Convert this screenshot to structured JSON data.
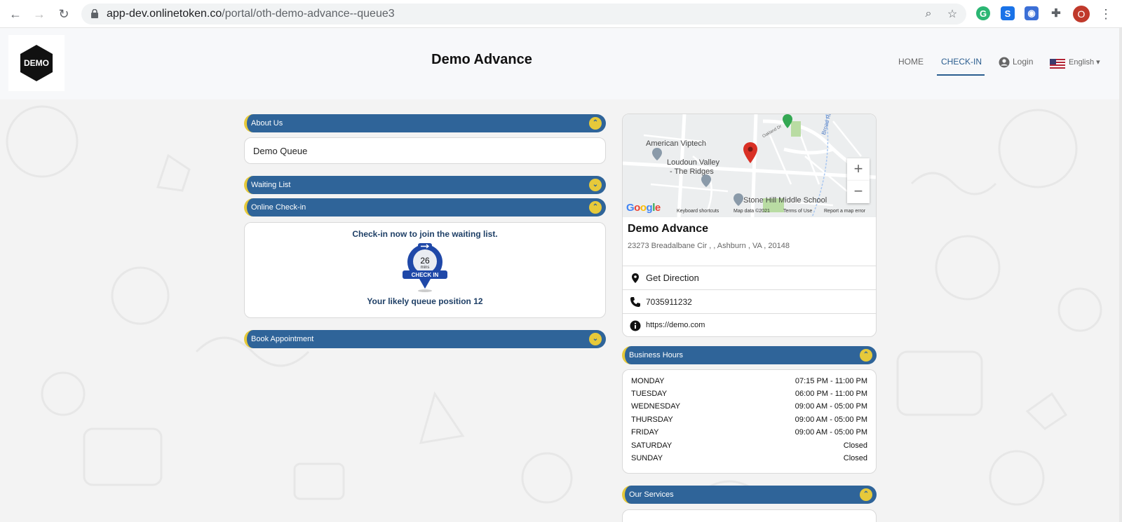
{
  "browser": {
    "url_host": "app-dev.onlinetoken.co",
    "url_path": "/portal/oth-demo-advance--queue3",
    "avatar_letter": "O"
  },
  "header": {
    "logo_text": "DEMO",
    "title": "Demo Advance",
    "nav": {
      "home": "HOME",
      "checkin": "CHECK-IN",
      "login": "Login",
      "language": "English"
    }
  },
  "about": {
    "label": "About Us",
    "text": "Demo Queue"
  },
  "waiting_list": {
    "label": "Waiting List"
  },
  "online_checkin": {
    "label": "Online Check-in",
    "heading": "Check-in now to join the waiting list.",
    "wait_minutes": "26",
    "wait_unit": "mins",
    "badge_label": "CHECK IN",
    "position_text": "Your likely queue position 12"
  },
  "book_appointment": {
    "label": "Book Appointment"
  },
  "map": {
    "labels": [
      "American Viptech",
      "Loudoun Valley",
      "- The Ridges",
      "Stone Hill Middle School",
      "Broad Run",
      "Oakland Dr"
    ],
    "footer": [
      "Keyboard shortcuts",
      "Map data ©2021",
      "Terms of Use",
      "Report a map error"
    ],
    "google": "Google"
  },
  "business": {
    "name": "Demo Advance",
    "address": "23273 Breadalbane Cir , , Ashburn , VA , 20148",
    "direction_label": "Get Direction",
    "phone": "7035911232",
    "website": "https://demo.com"
  },
  "hours": {
    "label": "Business Hours",
    "rows": [
      {
        "day": "MONDAY",
        "hours": "07:15 PM - 11:00 PM"
      },
      {
        "day": "TUESDAY",
        "hours": "06:00 PM - 11:00 PM"
      },
      {
        "day": "WEDNESDAY",
        "hours": "09:00 AM - 05:00 PM"
      },
      {
        "day": "THURSDAY",
        "hours": "09:00 AM - 05:00 PM"
      },
      {
        "day": "FRIDAY",
        "hours": "09:00 AM - 05:00 PM"
      },
      {
        "day": "SATURDAY",
        "hours": "Closed"
      },
      {
        "day": "SUNDAY",
        "hours": "Closed"
      }
    ]
  },
  "services": {
    "label": "Our Services"
  },
  "colors": {
    "accent": "#2f6499",
    "highlight": "#e6c93a",
    "nav_active": "#2a5d8f"
  }
}
